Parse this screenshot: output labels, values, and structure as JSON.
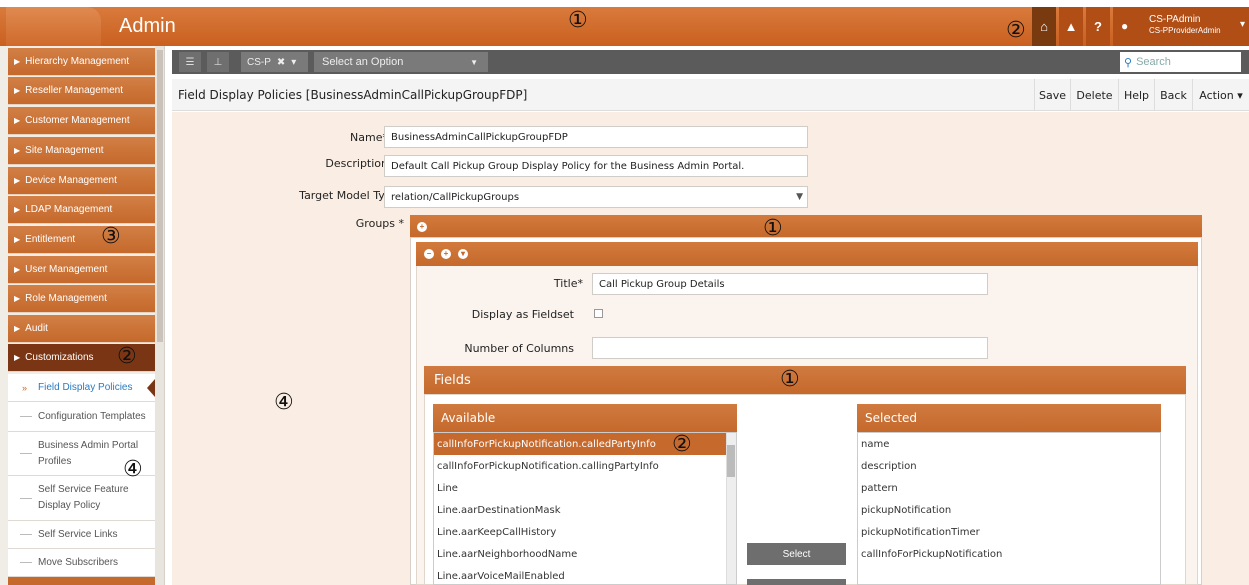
{
  "header": {
    "app_title": "Admin",
    "marker_1": "①",
    "marker_2": "②",
    "home_icon": "home-icon",
    "warning_icon": "warning-icon",
    "help_label": "?",
    "user_name": "CS-PAdmin",
    "user_role": "CS-PProviderAdmin"
  },
  "sidebar": {
    "items": [
      {
        "label": "Hierarchy Management"
      },
      {
        "label": "Reseller Management"
      },
      {
        "label": "Customer Management"
      },
      {
        "label": "Site Management"
      },
      {
        "label": "Device Management"
      },
      {
        "label": "LDAP Management"
      },
      {
        "label": "Entitlement"
      },
      {
        "label": "User Management"
      },
      {
        "label": "Role Management"
      },
      {
        "label": "Audit"
      },
      {
        "label": "Customizations"
      }
    ],
    "sub_items": [
      {
        "label": "Field Display Policies"
      },
      {
        "label": "Configuration Templates"
      },
      {
        "label": "Business Admin Portal Profiles"
      },
      {
        "label": "Self Service Feature Display Policy"
      },
      {
        "label": "Self Service Links"
      },
      {
        "label": "Move Subscribers"
      }
    ],
    "marker_3": "③",
    "marker_2": "②",
    "marker_4": "④"
  },
  "toolbar": {
    "chip_label": "CS-P",
    "chip_close": "✖",
    "chip_caret": "▾",
    "select_placeholder": "Select an Option",
    "search_placeholder": "Search"
  },
  "titlebar": {
    "title": "Field Display Policies [BusinessAdminCallPickupGroupFDP]",
    "save": "Save",
    "delete": "Delete",
    "help": "Help",
    "back": "Back",
    "action": "Action ▾"
  },
  "form": {
    "name_label": "Name*",
    "name_value": "BusinessAdminCallPickupGroupFDP",
    "description_label": "Description",
    "description_value": "Default Call Pickup Group Display Policy for the Business Admin Portal.",
    "target_label": "Target Model Type*",
    "target_value": "relation/CallPickupGroups",
    "groups_label": "Groups *",
    "marker_1": "①",
    "marker_4": "④",
    "title_label": "Title*",
    "title_value": "Call Pickup Group Details",
    "fieldset_label": "Display as Fieldset",
    "columns_label": "Number of Columns",
    "columns_value": ""
  },
  "fields": {
    "heading": "Fields",
    "marker_1": "①",
    "marker_2": "②",
    "available_heading": "Available",
    "selected_heading": "Selected",
    "available": [
      "callInfoForPickupNotification.calledPartyInfo",
      "callInfoForPickupNotification.callingPartyInfo",
      "Line",
      "Line.aarDestinationMask",
      "Line.aarKeepCallHistory",
      "Line.aarNeighborhoodName",
      "Line.aarVoiceMailEnabled"
    ],
    "selected": [
      "name",
      "description",
      "pattern",
      "pickupNotification",
      "pickupNotificationTimer",
      "callInfoForPickupNotification"
    ],
    "select_button": "Select"
  }
}
